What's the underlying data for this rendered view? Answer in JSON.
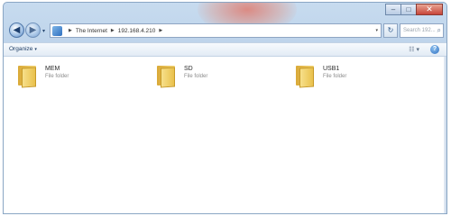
{
  "window": {
    "caption_buttons": {
      "minimize": "–",
      "maximize": "□",
      "close": "✕"
    }
  },
  "nav": {
    "back_icon": "back-arrow-icon",
    "forward_icon": "forward-arrow-icon",
    "recent_icon": "▾",
    "address": {
      "crumbs": [
        "The Internet",
        "192.168.4.210"
      ],
      "dropdown_icon": "▾"
    },
    "refresh_icon": "↻",
    "search": {
      "placeholder": "Search 192...",
      "icon": "⌕"
    }
  },
  "toolbar": {
    "organize_label": "Organize",
    "organize_arrow": "▾",
    "views_icon": "☷ ▾",
    "help_icon": "?"
  },
  "folders": [
    {
      "name": "MEM",
      "type": "File folder"
    },
    {
      "name": "SD",
      "type": "File folder"
    },
    {
      "name": "USB1",
      "type": "File folder"
    }
  ]
}
